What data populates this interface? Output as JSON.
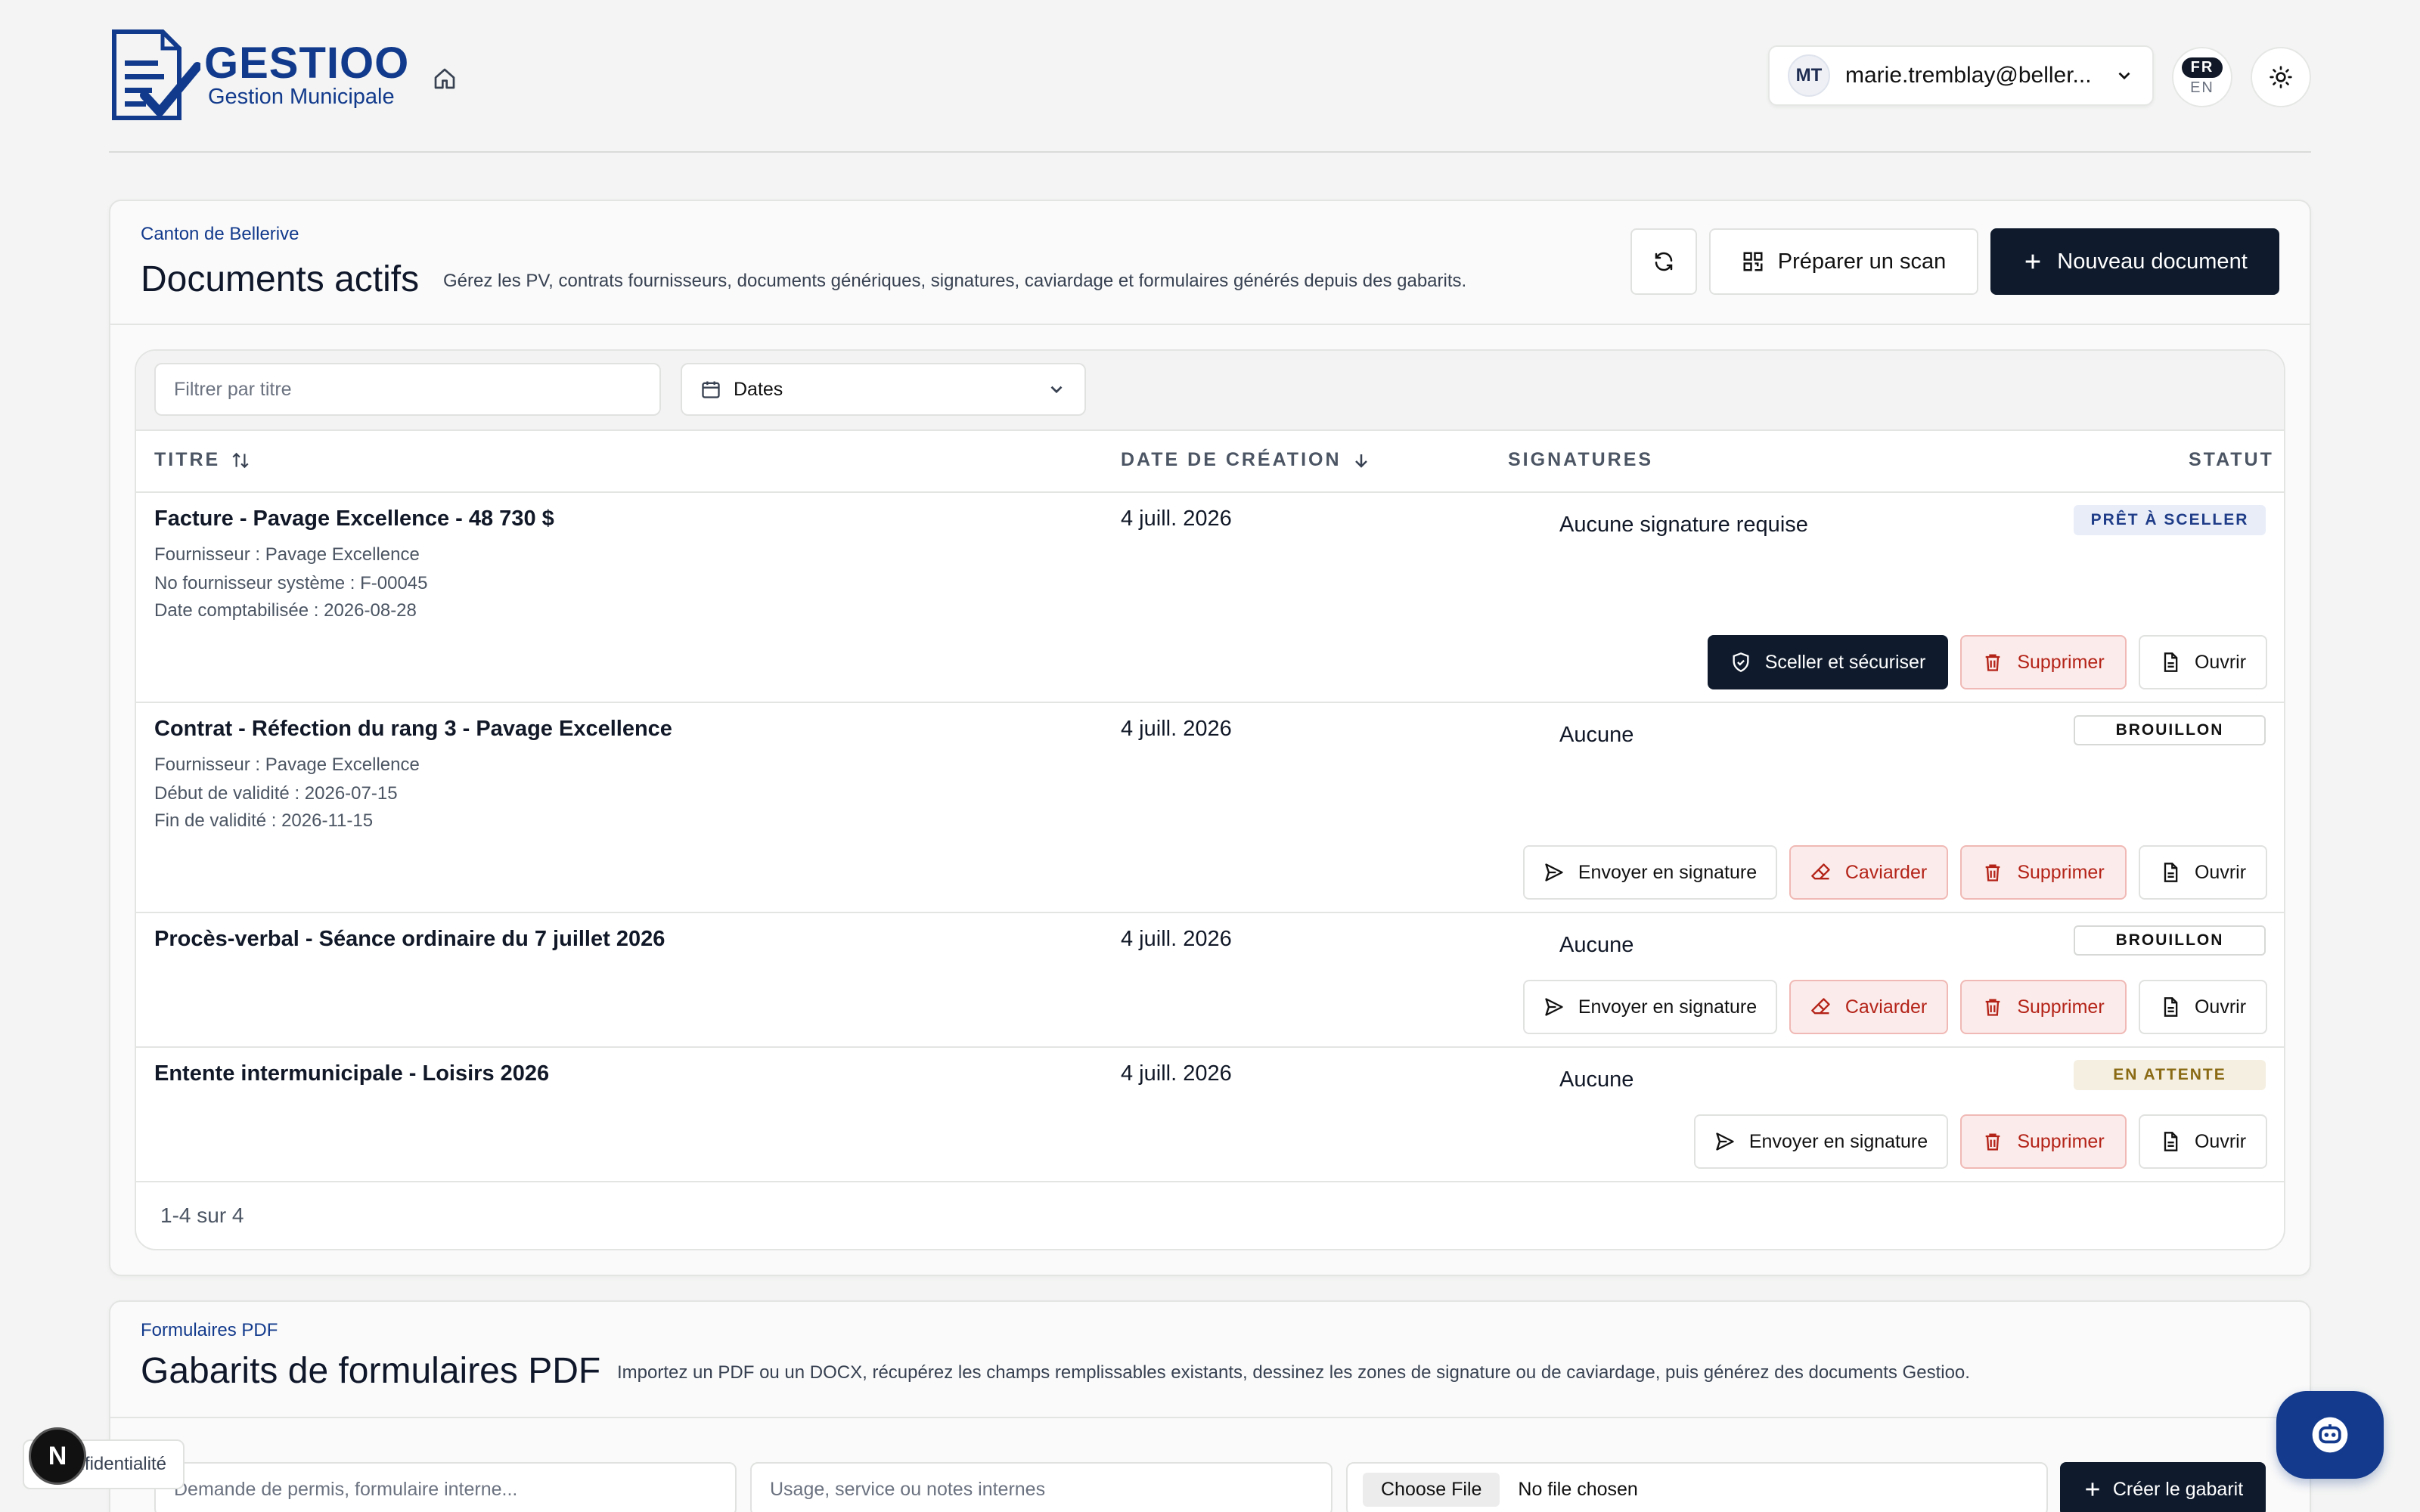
{
  "brand": {
    "name": "GESTIOO",
    "subtitle": "Gestion Municipale",
    "primary_color": "#123a8c",
    "dark_color": "#0f1b2d"
  },
  "header": {
    "user_initials": "MT",
    "user_email": "marie.tremblay@beller...",
    "lang_active": "FR",
    "lang_other": "EN"
  },
  "documents_card": {
    "eyebrow": "Canton de Bellerive",
    "title": "Documents actifs",
    "description": "Gérez les PV, contrats fournisseurs, documents génériques, signatures, caviardage et formulaires générés depuis des gabarits.",
    "scan_label": "Préparer un scan",
    "new_label": "Nouveau document",
    "filter_placeholder": "Filtrer par titre",
    "dates_label": "Dates",
    "columns": {
      "title": "TITRE",
      "created": "DATE DE CRÉATION",
      "signatures": "SIGNATURES",
      "status": "STATUT"
    },
    "rows": [
      {
        "title": "Facture - Pavage Excellence - 48 730 $",
        "meta": [
          "Fournisseur : Pavage Excellence",
          "No fournisseur système : F-00045",
          "Date comptabilisée : 2026-08-28"
        ],
        "date": "4 juill. 2026",
        "signatures": "Aucune signature requise",
        "status": "PRÊT À SCELLER",
        "actions": {
          "seal": "Sceller et sécuriser",
          "delete": "Supprimer",
          "open": "Ouvrir"
        }
      },
      {
        "title": "Contrat - Réfection du rang 3 - Pavage Excellence",
        "meta": [
          "Fournisseur : Pavage Excellence",
          "Début de validité : 2026-07-15",
          "Fin de validité : 2026-11-15"
        ],
        "date": "4 juill. 2026",
        "signatures": "Aucune",
        "status": "BROUILLON",
        "actions": {
          "send": "Envoyer en signature",
          "redact": "Caviarder",
          "delete": "Supprimer",
          "open": "Ouvrir"
        }
      },
      {
        "title": "Procès-verbal - Séance ordinaire du 7 juillet 2026",
        "meta": [],
        "date": "4 juill. 2026",
        "signatures": "Aucune",
        "status": "BROUILLON",
        "actions": {
          "send": "Envoyer en signature",
          "redact": "Caviarder",
          "delete": "Supprimer",
          "open": "Ouvrir"
        }
      },
      {
        "title": "Entente intermunicipale - Loisirs 2026",
        "meta": [],
        "date": "4 juill. 2026",
        "signatures": "Aucune",
        "status": "EN ATTENTE",
        "actions": {
          "send": "Envoyer en signature",
          "delete": "Supprimer",
          "open": "Ouvrir"
        }
      }
    ],
    "pagination": "1-4 sur 4"
  },
  "forms_card": {
    "eyebrow": "Formulaires PDF",
    "title": "Gabarits de formulaires PDF",
    "description": "Importez un PDF ou un DOCX, récupérez les champs remplissables existants, dessinez les zones de signature ou de caviardage, puis générez des documents Gestioo.",
    "name_placeholder": "Demande de permis, formulaire interne...",
    "usage_placeholder": "Usage, service ou notes internes",
    "choose_file": "Choose File",
    "no_file": "No file chosen",
    "create_label": "Créer le gabarit"
  },
  "privacy_label": "Confidentialité",
  "nx_label": "N"
}
